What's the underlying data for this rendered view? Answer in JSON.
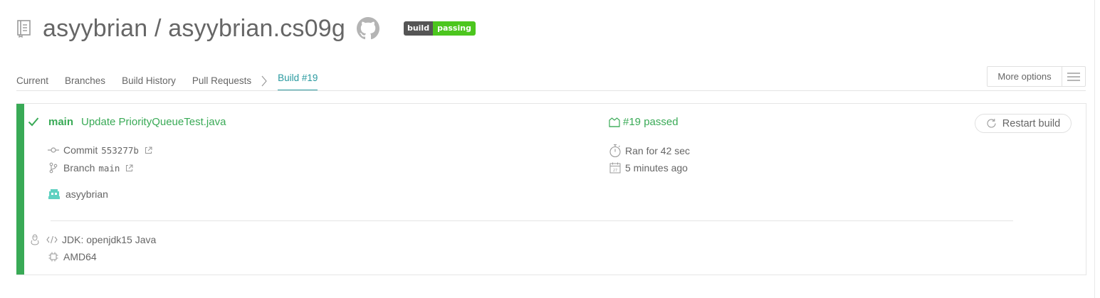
{
  "header": {
    "repo_title": "asyybrian / asyybrian.cs09g",
    "badge_left": "build",
    "badge_right": "passing"
  },
  "tabs": [
    {
      "label": "Current"
    },
    {
      "label": "Branches"
    },
    {
      "label": "Build History"
    },
    {
      "label": "Pull Requests"
    },
    {
      "label": "Build #19",
      "active": true
    }
  ],
  "more_options": {
    "label": "More options"
  },
  "build": {
    "branch": "main",
    "commit_message": "Update PriorityQueueTest.java",
    "commit_label": "Commit",
    "commit_sha": "553277b",
    "branch_label": "Branch",
    "branch_value": "main",
    "author": "asyybrian",
    "status": "#19 passed",
    "duration": "Ran for 42 sec",
    "finished": "5 minutes ago",
    "jdk": "JDK: openjdk15 Java",
    "arch": "AMD64",
    "restart_label": "Restart build"
  },
  "colors": {
    "passed": "#39aa56",
    "active_tab": "#2a9aa0",
    "badge_dark": "#555555",
    "badge_green": "#4cc61e"
  },
  "icons": [
    "repo-icon",
    "github-icon",
    "chevron-right-icon",
    "hamburger-icon",
    "check-icon",
    "commit-icon",
    "external-link-icon",
    "branch-icon",
    "avatar",
    "linux-icon",
    "code-icon",
    "cpu-icon",
    "build-passed-icon",
    "stopwatch-icon",
    "calendar-icon",
    "restart-icon"
  ]
}
